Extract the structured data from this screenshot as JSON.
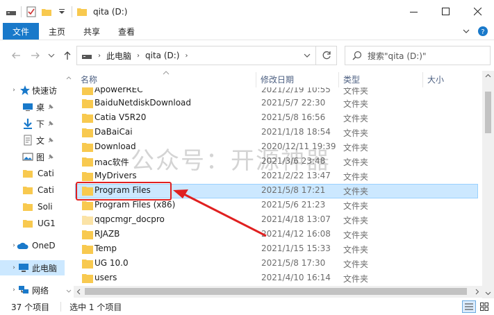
{
  "window": {
    "title": "qita (D:)"
  },
  "ribbon": {
    "tabs": [
      "文件",
      "主页",
      "共享",
      "查看"
    ]
  },
  "address": {
    "crumbs": [
      "此电脑",
      "qita (D:)"
    ],
    "search_placeholder": "搜索\"qita (D:)\""
  },
  "nav": {
    "items": [
      {
        "label": "快速访",
        "icon": "star-icon"
      },
      {
        "label": "桌",
        "icon": "desktop-icon"
      },
      {
        "label": "下",
        "icon": "download-icon"
      },
      {
        "label": "文",
        "icon": "document-icon"
      },
      {
        "label": "图",
        "icon": "picture-icon"
      },
      {
        "label": "Cati",
        "icon": "folder-icon"
      },
      {
        "label": "Cati",
        "icon": "folder-icon"
      },
      {
        "label": "Soli",
        "icon": "folder-icon"
      },
      {
        "label": "UG1",
        "icon": "folder-icon"
      },
      {
        "label": "OneD",
        "icon": "cloud-icon"
      },
      {
        "label": "此电脑",
        "icon": "pc-icon"
      },
      {
        "label": "网络",
        "icon": "network-icon"
      }
    ]
  },
  "columns": {
    "name": "名称",
    "date": "修改日期",
    "type": "类型",
    "size": "大小"
  },
  "files": [
    {
      "name": "ApowerREC",
      "date": "2021/2/19 10:55",
      "type": "文件夹",
      "partial": true
    },
    {
      "name": "BaiduNetdiskDownload",
      "date": "2021/5/7 22:30",
      "type": "文件夹"
    },
    {
      "name": "Catia V5R20",
      "date": "2021/5/8 16:56",
      "type": "文件夹"
    },
    {
      "name": "DaBaiCai",
      "date": "2021/1/18 18:54",
      "type": "文件夹"
    },
    {
      "name": "Download",
      "date": "2020/12/11 19:39",
      "type": "文件夹"
    },
    {
      "name": "mac软件",
      "date": "2021/3/6 23:48",
      "type": "文件夹"
    },
    {
      "name": "MyDrivers",
      "date": "2021/2/22 13:47",
      "type": "文件夹"
    },
    {
      "name": "Program Files",
      "date": "2021/5/8 17:21",
      "type": "文件夹",
      "selected": true
    },
    {
      "name": "Program Files (x86)",
      "date": "2021/5/6 21:23",
      "type": "文件夹"
    },
    {
      "name": "qqpcmgr_docpro",
      "date": "2021/4/18 13:07",
      "type": "文件夹",
      "faded": true
    },
    {
      "name": "RJAZB",
      "date": "2021/4/12 16:08",
      "type": "文件夹"
    },
    {
      "name": "Temp",
      "date": "2021/1/15 15:33",
      "type": "文件夹"
    },
    {
      "name": "UG 10.0",
      "date": "2021/5/8 17:30",
      "type": "文件夹"
    },
    {
      "name": "users",
      "date": "2021/4/10 16:14",
      "type": "文件夹"
    }
  ],
  "status": {
    "count": "37 个项目",
    "selection": "选中 1 个项目"
  },
  "watermark": "公众号：开源神器",
  "colors": {
    "accent": "#1979ca",
    "selection": "#cce8ff",
    "folder": "#f8c94f",
    "annotation": "#e02020"
  }
}
